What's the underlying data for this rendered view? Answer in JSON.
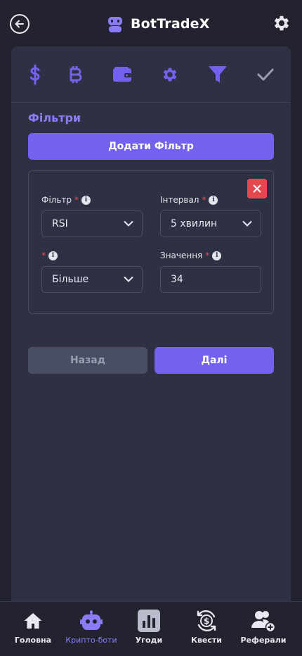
{
  "header": {
    "title": "BotTradeX",
    "back_icon": "arrow-left-circle-icon",
    "settings_icon": "gear-icon"
  },
  "steps": [
    {
      "icon": "dollar-icon",
      "state": "done"
    },
    {
      "icon": "bitcoin-icon",
      "state": "done"
    },
    {
      "icon": "wallet-icon",
      "state": "done"
    },
    {
      "icon": "gear-icon",
      "state": "done"
    },
    {
      "icon": "filter-icon",
      "state": "active"
    },
    {
      "icon": "check-icon",
      "state": "pending"
    }
  ],
  "filters": {
    "title": "Фільтри",
    "add_button": "Додати Фільтр",
    "row": {
      "filter_label": "Фільтр",
      "filter_value": "RSI",
      "interval_label": "Інтервал",
      "interval_value": "5 хвилин",
      "condition_value": "Більше",
      "value_label": "Значення",
      "value_value": "34"
    }
  },
  "actions": {
    "back": "Назад",
    "next": "Далі"
  },
  "nav": [
    {
      "label": "Головна",
      "icon": "home-icon",
      "active": false
    },
    {
      "label": "Крипто-боти",
      "icon": "robot-icon",
      "active": true
    },
    {
      "label": "Угоди",
      "icon": "bar-chart-icon",
      "active": false
    },
    {
      "label": "Квести",
      "icon": "coin-cycle-icon",
      "active": false
    },
    {
      "label": "Реферали",
      "icon": "add-users-icon",
      "active": false
    }
  ],
  "colors": {
    "accent": "#7462ee",
    "accent_text": "#8b7cf6",
    "background": "#22232f",
    "panel": "#2e3144",
    "danger": "#e5484d"
  }
}
